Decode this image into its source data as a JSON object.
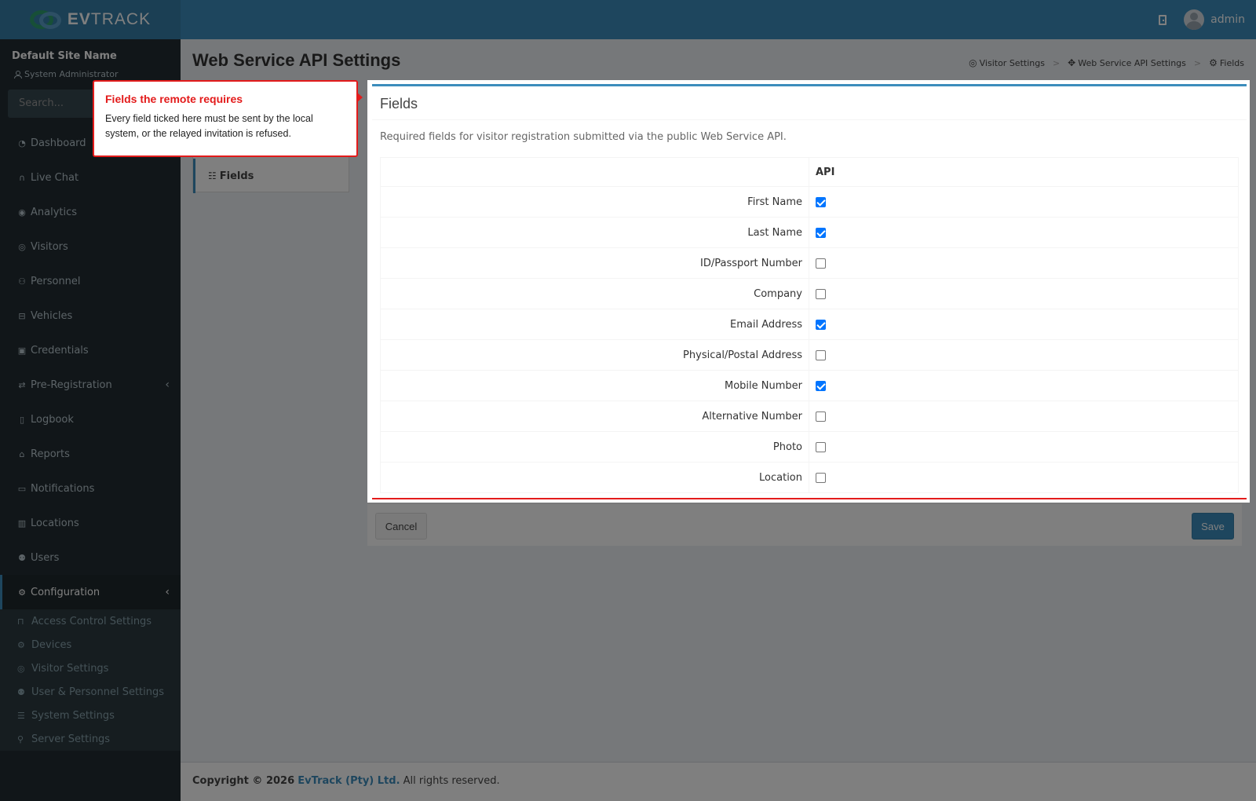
{
  "header": {
    "brand_bold": "EV",
    "brand_rest": "TRACK",
    "user_name": "admin"
  },
  "sidebar": {
    "site_name": "Default Site Name",
    "role": "System Administrator",
    "search_placeholder": "Search...",
    "items": [
      {
        "label": "Dashboard",
        "icon": "dashboard-icon"
      },
      {
        "label": "Live Chat",
        "icon": "headset-icon"
      },
      {
        "label": "Analytics",
        "icon": "analytics-icon"
      },
      {
        "label": "Visitors",
        "icon": "eye-icon"
      },
      {
        "label": "Personnel",
        "icon": "personnel-icon"
      },
      {
        "label": "Vehicles",
        "icon": "car-icon"
      },
      {
        "label": "Credentials",
        "icon": "id-card-icon"
      },
      {
        "label": "Pre-Registration",
        "icon": "arrows-icon"
      },
      {
        "label": "Logbook",
        "icon": "book-icon"
      },
      {
        "label": "Reports",
        "icon": "chart-icon"
      },
      {
        "label": "Notifications",
        "icon": "chat-icon"
      },
      {
        "label": "Locations",
        "icon": "map-icon"
      },
      {
        "label": "Users",
        "icon": "users-icon"
      },
      {
        "label": "Configuration",
        "icon": "gear-icon"
      }
    ],
    "config_sub": [
      {
        "label": "Access Control Settings",
        "icon": "lock-icon"
      },
      {
        "label": "Devices",
        "icon": "devices-icon"
      },
      {
        "label": "Visitor Settings",
        "icon": "eye-icon"
      },
      {
        "label": "User & Personnel Settings",
        "icon": "users-icon"
      },
      {
        "label": "System Settings",
        "icon": "sliders-icon"
      },
      {
        "label": "Server Settings",
        "icon": "server-icon"
      }
    ]
  },
  "page": {
    "title": "Web Service API Settings",
    "breadcrumb": [
      "Visitor Settings",
      "Web Service API Settings",
      "Fields"
    ],
    "side_tab": "Fields"
  },
  "fields_box": {
    "title": "Fields",
    "description": "Required fields for visitor registration submitted via the public Web Service API.",
    "column_header": "API",
    "rows": [
      {
        "label": "First Name",
        "checked": true
      },
      {
        "label": "Last Name",
        "checked": true
      },
      {
        "label": "ID/Passport Number",
        "checked": false
      },
      {
        "label": "Company",
        "checked": false
      },
      {
        "label": "Email Address",
        "checked": true
      },
      {
        "label": "Physical/Postal Address",
        "checked": false
      },
      {
        "label": "Mobile Number",
        "checked": true
      },
      {
        "label": "Alternative Number",
        "checked": false
      },
      {
        "label": "Photo",
        "checked": false
      },
      {
        "label": "Location",
        "checked": false
      }
    ]
  },
  "actions": {
    "cancel": "Cancel",
    "save": "Save"
  },
  "footer": {
    "prefix": "Copyright © 2026",
    "company": "EvTrack (Pty) Ltd.",
    "suffix": "All rights reserved."
  },
  "tooltip": {
    "title": "Fields the remote requires",
    "body": "Every field ticked here must be sent by the local system, or the relayed invitation is refused."
  },
  "colors": {
    "primary": "#3c8dbc",
    "sidebar": "#222d32",
    "highlight": "#e31b1b"
  }
}
